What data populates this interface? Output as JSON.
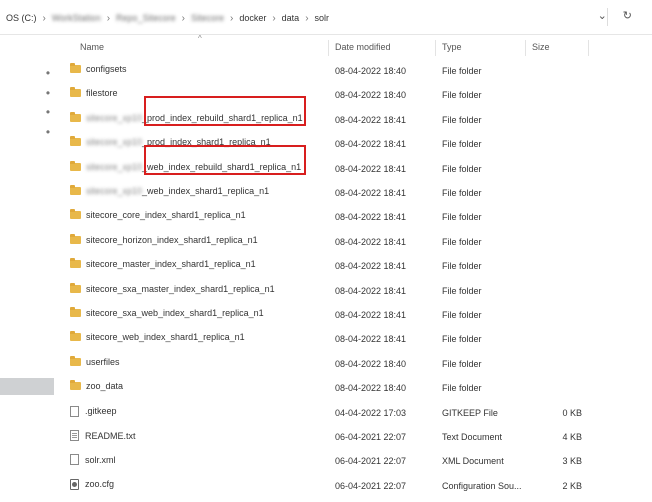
{
  "address": {
    "crumbs": [
      "OS (C:)",
      "WorkStation",
      "Repo_Sitecore",
      "Sitecore",
      "docker",
      "data",
      "solr"
    ],
    "blurred_crumbs": [
      1,
      2,
      3
    ],
    "chevron": "chevron-down-icon",
    "refresh": "refresh-icon"
  },
  "columns": {
    "name": "Name",
    "date": "Date modified",
    "type": "Type",
    "size": "Size"
  },
  "rows": [
    {
      "prefix": "",
      "name": "configsets",
      "date": "08-04-2022 18:40",
      "type": "File folder",
      "size": "",
      "icon": "folder-icon"
    },
    {
      "prefix": "",
      "name": "filestore",
      "date": "08-04-2022 18:40",
      "type": "File folder",
      "size": "",
      "icon": "folder-icon"
    },
    {
      "prefix": "sitecore_xp10",
      "name": "_prod_index_rebuild_shard1_replica_n1",
      "date": "08-04-2022 18:41",
      "type": "File folder",
      "size": "",
      "icon": "folder-icon"
    },
    {
      "prefix": "sitecore_xp10",
      "name": "_prod_index_shard1_replica_n1",
      "date": "08-04-2022 18:41",
      "type": "File folder",
      "size": "",
      "icon": "folder-icon"
    },
    {
      "prefix": "sitecore_xp10",
      "name": "_web_index_rebuild_shard1_replica_n1",
      "date": "08-04-2022 18:41",
      "type": "File folder",
      "size": "",
      "icon": "folder-icon"
    },
    {
      "prefix": "sitecore_xp10",
      "name": "_web_index_shard1_replica_n1",
      "date": "08-04-2022 18:41",
      "type": "File folder",
      "size": "",
      "icon": "folder-icon"
    },
    {
      "prefix": "",
      "name": "sitecore_core_index_shard1_replica_n1",
      "date": "08-04-2022 18:41",
      "type": "File folder",
      "size": "",
      "icon": "folder-icon"
    },
    {
      "prefix": "",
      "name": "sitecore_horizon_index_shard1_replica_n1",
      "date": "08-04-2022 18:41",
      "type": "File folder",
      "size": "",
      "icon": "folder-icon"
    },
    {
      "prefix": "",
      "name": "sitecore_master_index_shard1_replica_n1",
      "date": "08-04-2022 18:41",
      "type": "File folder",
      "size": "",
      "icon": "folder-icon"
    },
    {
      "prefix": "",
      "name": "sitecore_sxa_master_index_shard1_replica_n1",
      "date": "08-04-2022 18:41",
      "type": "File folder",
      "size": "",
      "icon": "folder-icon"
    },
    {
      "prefix": "",
      "name": "sitecore_sxa_web_index_shard1_replica_n1",
      "date": "08-04-2022 18:41",
      "type": "File folder",
      "size": "",
      "icon": "folder-icon"
    },
    {
      "prefix": "",
      "name": "sitecore_web_index_shard1_replica_n1",
      "date": "08-04-2022 18:41",
      "type": "File folder",
      "size": "",
      "icon": "folder-icon"
    },
    {
      "prefix": "",
      "name": "userfiles",
      "date": "08-04-2022 18:40",
      "type": "File folder",
      "size": "",
      "icon": "folder-icon"
    },
    {
      "prefix": "",
      "name": "zoo_data",
      "date": "08-04-2022 18:40",
      "type": "File folder",
      "size": "",
      "icon": "folder-icon"
    },
    {
      "prefix": "",
      "name": ".gitkeep",
      "date": "04-04-2022 17:03",
      "type": "GITKEEP File",
      "size": "0 KB",
      "icon": "file-icon"
    },
    {
      "prefix": "",
      "name": "README.txt",
      "date": "06-04-2021 22:07",
      "type": "Text Document",
      "size": "4 KB",
      "icon": "text-file-icon"
    },
    {
      "prefix": "",
      "name": "solr.xml",
      "date": "06-04-2021 22:07",
      "type": "XML Document",
      "size": "3 KB",
      "icon": "xml-file-icon"
    },
    {
      "prefix": "",
      "name": "zoo.cfg",
      "date": "06-04-2021 22:07",
      "type": "Configuration Sou...",
      "size": "2 KB",
      "icon": "config-file-icon"
    }
  ],
  "highlighted_rows": [
    2,
    4
  ],
  "highlight_color": "#d81e1e",
  "folder_color": "#e8b84a",
  "pinned_rows": 4,
  "pin_icon": "pin-icon"
}
